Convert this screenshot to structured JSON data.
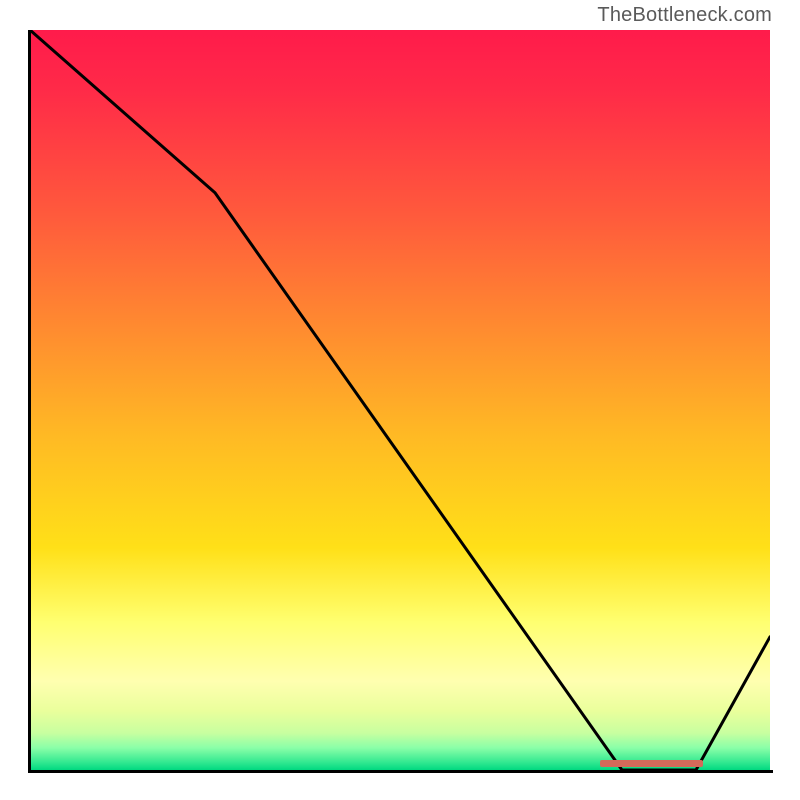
{
  "watermark": "TheBottleneck.com",
  "chart_data": {
    "type": "line",
    "title": "",
    "xlabel": "",
    "ylabel": "",
    "xlim": [
      0,
      100
    ],
    "ylim": [
      0,
      100
    ],
    "grid": false,
    "x": [
      0,
      25,
      80,
      90,
      100
    ],
    "values": [
      100,
      78,
      0,
      0,
      18
    ],
    "marker": {
      "x_start": 77,
      "x_end": 91,
      "y": 0
    },
    "background_gradient": {
      "stops": [
        {
          "pos": 0,
          "color": "#ff1b4b"
        },
        {
          "pos": 25,
          "color": "#ff5a3c"
        },
        {
          "pos": 55,
          "color": "#ffba24"
        },
        {
          "pos": 80,
          "color": "#ffff70"
        },
        {
          "pos": 95,
          "color": "#c8ffa0"
        },
        {
          "pos": 100,
          "color": "#00d880"
        }
      ]
    }
  }
}
